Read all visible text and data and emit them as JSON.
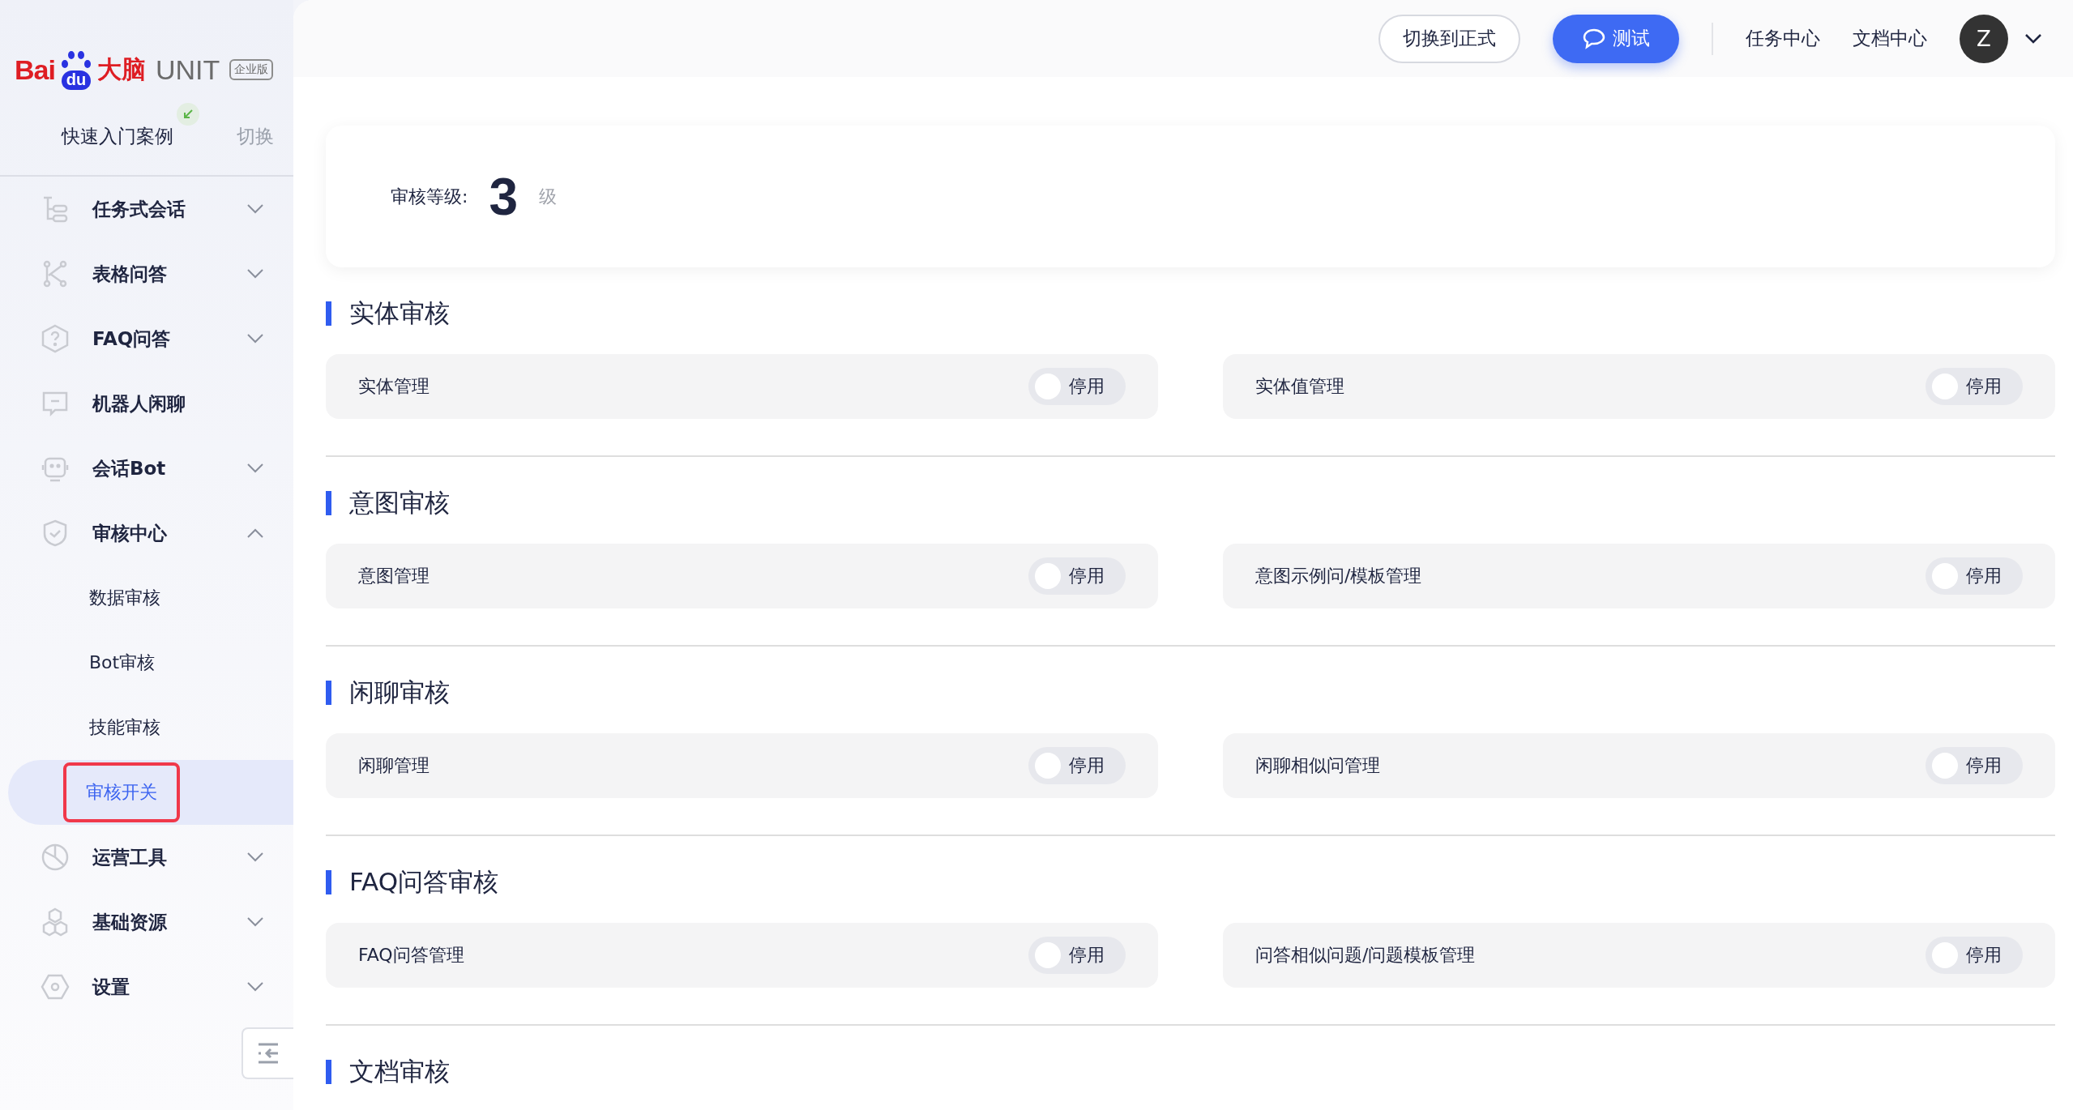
{
  "sidebar": {
    "logo": {
      "brand_left": "Bai",
      "brand_paw": "du",
      "brand_cn": "大脑",
      "product": "UNIT",
      "edition": "企业版"
    },
    "project": {
      "name": "快速入门案例",
      "switch": "切换"
    },
    "items": [
      {
        "label": "任务式会话",
        "expanded": false
      },
      {
        "label": "表格问答",
        "expanded": false
      },
      {
        "label": "FAQ问答",
        "expanded": false
      },
      {
        "label": "机器人闲聊"
      },
      {
        "label": "会话Bot",
        "expanded": false
      },
      {
        "label": "审核中心",
        "expanded": true,
        "children": [
          {
            "label": "数据审核",
            "selected": false
          },
          {
            "label": "Bot审核",
            "selected": false
          },
          {
            "label": "技能审核",
            "selected": false
          },
          {
            "label": "审核开关",
            "selected": true
          }
        ]
      },
      {
        "label": "运营工具",
        "expanded": false
      },
      {
        "label": "基础资源",
        "expanded": false
      },
      {
        "label": "设置",
        "expanded": false
      }
    ]
  },
  "topbar": {
    "switch_button": "切换到正式",
    "test_button": "测试",
    "links": [
      "任务中心",
      "文档中心"
    ],
    "avatar": "Z"
  },
  "level": {
    "label": "审核等级:",
    "value": "3",
    "unit": "级"
  },
  "sections": [
    {
      "title": "实体审核",
      "items": [
        {
          "label": "实体管理",
          "on": false,
          "state_label": "停用"
        },
        {
          "label": "实体值管理",
          "on": false,
          "state_label": "停用"
        }
      ]
    },
    {
      "title": "意图审核",
      "items": [
        {
          "label": "意图管理",
          "on": false,
          "state_label": "停用"
        },
        {
          "label": "意图示例问/模板管理",
          "on": false,
          "state_label": "停用"
        }
      ]
    },
    {
      "title": "闲聊审核",
      "items": [
        {
          "label": "闲聊管理",
          "on": false,
          "state_label": "停用"
        },
        {
          "label": "闲聊相似问管理",
          "on": false,
          "state_label": "停用"
        }
      ]
    },
    {
      "title": "FAQ问答审核",
      "items": [
        {
          "label": "FAQ问答管理",
          "on": false,
          "state_label": "停用"
        },
        {
          "label": "问答相似问题/问题模板管理",
          "on": false,
          "state_label": "停用"
        }
      ]
    },
    {
      "title": "文档审核"
    }
  ]
}
